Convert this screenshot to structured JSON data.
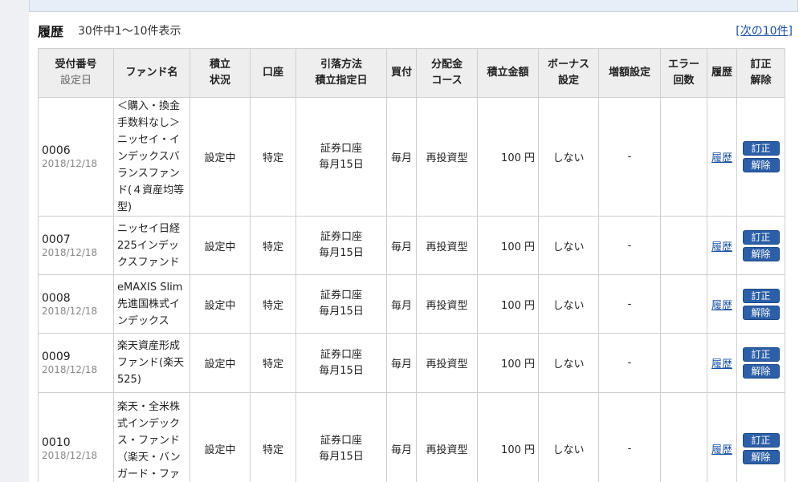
{
  "section": {
    "title": "履歴",
    "count_text": "30件中1～10件表示",
    "next_link": "[次の10件]"
  },
  "columns": {
    "id_line1": "受付番号",
    "id_line2": "設定日",
    "fund": "ファンド名",
    "status_l1": "積立",
    "status_l2": "状況",
    "account": "口座",
    "method_l1": "引落方法",
    "method_l2": "積立指定日",
    "freq": "買付",
    "dist_l1": "分配金",
    "dist_l2": "コース",
    "amount": "積立金額",
    "bonus_l1": "ボーナス",
    "bonus_l2": "設定",
    "increase": "増額設定",
    "error_l1": "エラー",
    "error_l2": "回数",
    "history": "履歴",
    "edit_l1": "訂正",
    "edit_l2": "解除"
  },
  "rows": [
    {
      "id": "0006",
      "date": "2018/12/18",
      "fund": "＜購入・換金手数料なし＞ニッセイ・インデックスバランスファンド(４資産均等型)",
      "status": "設定中",
      "account": "特定",
      "method1": "証券口座",
      "method2": "毎月15日",
      "freq": "毎月",
      "dist": "再投資型",
      "amount": "100 円",
      "bonus": "しない",
      "increase": "-",
      "history": "履歴",
      "edit": "訂正",
      "cancel": "解除"
    },
    {
      "id": "0007",
      "date": "2018/12/18",
      "fund": "ニッセイ日経225インデックスファンド",
      "status": "設定中",
      "account": "特定",
      "method1": "証券口座",
      "method2": "毎月15日",
      "freq": "毎月",
      "dist": "再投資型",
      "amount": "100 円",
      "bonus": "しない",
      "increase": "-",
      "history": "履歴",
      "edit": "訂正",
      "cancel": "解除"
    },
    {
      "id": "0008",
      "date": "2018/12/18",
      "fund": "eMAXIS Slim先進国株式インデックス",
      "status": "設定中",
      "account": "特定",
      "method1": "証券口座",
      "method2": "毎月15日",
      "freq": "毎月",
      "dist": "再投資型",
      "amount": "100 円",
      "bonus": "しない",
      "increase": "-",
      "history": "履歴",
      "edit": "訂正",
      "cancel": "解除"
    },
    {
      "id": "0009",
      "date": "2018/12/18",
      "fund": "楽天資産形成ファンド(楽天525)",
      "status": "設定中",
      "account": "特定",
      "method1": "証券口座",
      "method2": "毎月15日",
      "freq": "毎月",
      "dist": "再投資型",
      "amount": "100 円",
      "bonus": "しない",
      "increase": "-",
      "history": "履歴",
      "edit": "訂正",
      "cancel": "解除"
    },
    {
      "id": "0010",
      "date": "2018/12/18",
      "fund": "楽天・全米株式インデックス・ファンド（楽天・バンガード・ファンド（全米株",
      "status": "設定中",
      "account": "特定",
      "method1": "証券口座",
      "method2": "毎月15日",
      "freq": "毎月",
      "dist": "再投資型",
      "amount": "100 円",
      "bonus": "しない",
      "increase": "-",
      "history": "履歴",
      "edit": "訂正",
      "cancel": "解除"
    }
  ]
}
